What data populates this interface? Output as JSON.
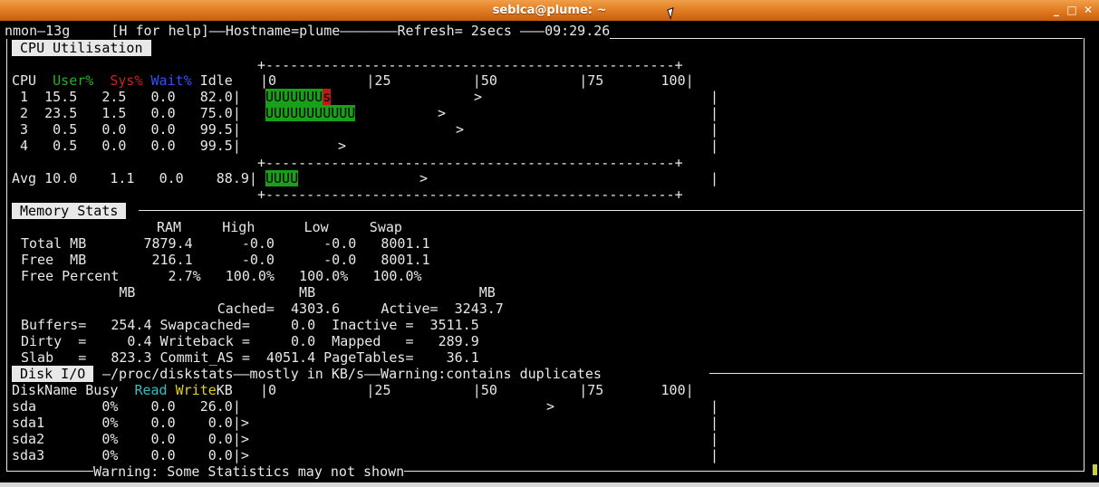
{
  "window": {
    "title": "seblca@plume: ~",
    "minimize": "_",
    "maximize": "□",
    "close": "✕"
  },
  "top": {
    "version": "nmon—13g",
    "help": "[H for help]",
    "hostname": "Hostname=plume",
    "refresh": "Refresh= 2secs",
    "time": "09:29.26"
  },
  "cpu": {
    "section": "CPU Utilisation",
    "head_cpu": "CPU",
    "head_user": "User%",
    "head_sys": "Sys%",
    "head_wait": "Wait%",
    "head_idle": "Idle",
    "scale": "|0           |25          |50          |75       100|",
    "rule": "+--------------------------------------------------+",
    "rows": [
      {
        "id": " 1",
        "user": "15.5",
        "sys": "2.5",
        "wait": "0.0",
        "idle": "82.0",
        "bar_u": "UUUUUUU",
        "bar_s": "s",
        "peak": ">"
      },
      {
        "id": " 2",
        "user": "23.5",
        "sys": "1.5",
        "wait": "0.0",
        "idle": "75.0",
        "bar_u": "UUUUUUUUUUU",
        "bar_s": "",
        "peak": ">"
      },
      {
        "id": " 3",
        "user": "0.5",
        "sys": "0.0",
        "wait": "0.0",
        "idle": "99.5",
        "bar_u": "",
        "bar_s": "",
        "peak": ">"
      },
      {
        "id": " 4",
        "user": "0.5",
        "sys": "0.0",
        "wait": "0.0",
        "idle": "99.5",
        "bar_u": "",
        "bar_s": "",
        "peak": ">"
      }
    ],
    "avg": {
      "id": "Avg",
      "user": "10.0",
      "sys": "1.1",
      "wait": "0.0",
      "idle": "88.9",
      "bar_u": "UUUU",
      "peak": ">"
    }
  },
  "memory": {
    "section": "Memory Stats",
    "header": "RAM     High      Low     Swap",
    "rows": [
      "Total MB       7879.4      -0.0      -0.0   8001.1",
      "Free  MB        216.1      -0.0      -0.0   8001.1",
      "Free Percent      2.7%   100.0%   100.0%   100.0%"
    ],
    "mb_header": "            MB                    MB                    MB",
    "details": [
      "                        Cached=  4303.6     Active=  3243.7",
      "Buffers=   254.4 Swapcached=     0.0  Inactive =  3511.5",
      "Dirty  =     0.4 Writeback =     0.0  Mapped   =   289.9",
      "Slab   =   823.3 Commit_AS =  4051.4 PageTables=    36.1"
    ]
  },
  "disk": {
    "section": "Disk I/O",
    "path": "—/proc/diskstats——mostly in KB/s——Warning:contains duplicates",
    "head_name": "DiskName Busy  ",
    "head_read": "Read",
    "head_write": "Write",
    "head_kb": "KB",
    "scale": "|0           |25          |50          |75       100|",
    "rows": [
      {
        "name": "sda        0%    0.0   26.0",
        "peak": ">"
      },
      {
        "name": "sda1       0%    0.0    0.0",
        "peak": ">"
      },
      {
        "name": "sda2       0%    0.0    0.0",
        "peak": ">"
      },
      {
        "name": "sda3       0%    0.0    0.0",
        "peak": ">"
      }
    ],
    "footer": "Warning: Some Statistics may not shown"
  }
}
